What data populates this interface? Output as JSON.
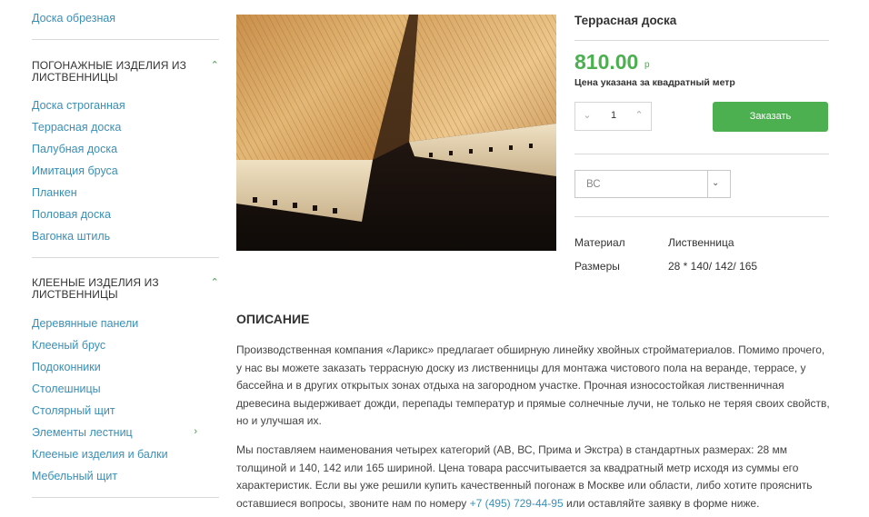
{
  "sidebar": {
    "top_link": "Доска обрезная",
    "groups": [
      {
        "heading": "Погонажные изделия из лиственницы",
        "items": [
          "Доска строганная",
          "Террасная доска",
          "Палубная доска",
          "Имитация бруса",
          "Планкен",
          "Половая доска",
          "Вагонка штиль"
        ]
      },
      {
        "heading": "Клееные изделия из лиственницы",
        "items": [
          "Деревянные панели",
          "Клееный брус",
          "Подоконники",
          "Столешницы",
          "Столярный щит",
          "Элементы лестниц",
          "Клееные изделия и балки",
          "Мебельный щит"
        ]
      }
    ]
  },
  "product": {
    "title": "Террасная доска",
    "price": "810.00",
    "currency": "р",
    "price_note": "Цена указана за квадратный метр",
    "quantity": "1",
    "order_label": "Заказать",
    "grade_selected": "ВС",
    "properties": [
      {
        "name": "Материал",
        "value": "Лиственница"
      },
      {
        "name": "Размеры",
        "value": "28 * 140/ 142/ 165"
      }
    ]
  },
  "description": {
    "title": "Описание",
    "para1": "Производственная компания «Ларикс» предлагает обширную линейку хвойных стройматериалов. Помимо прочего, у нас вы можете заказать террасную доску из лиственницы для монтажа чистового пола на веранде, террасе, у бассейна и в других открытых зонах отдыха на загородном участке. Прочная износостойкая лиственничная древесина выдерживает дожди, перепады температур и прямые солнечные лучи, не только не теряя своих свойств, но и улучшая их.",
    "para2_before": "Мы поставляем наименования четырех категорий (АВ, ВС, Прима и Экстра) в стандартных размерах: 28 мм толщиной и 140, 142 или 165 шириной. Цена товара рассчитывается за квадратный метр исходя из суммы его характеристик. Если вы уже решили купить качественный погонаж в Москве или области, либо хотите прояснить оставшиеся вопросы, звоните нам по номеру ",
    "phone": "+7 (495) 729-44-95",
    "para2_after": " или оставляйте заявку в форме ниже."
  },
  "colors": {
    "accent": "#4caf50",
    "link": "#3a8fb7"
  }
}
